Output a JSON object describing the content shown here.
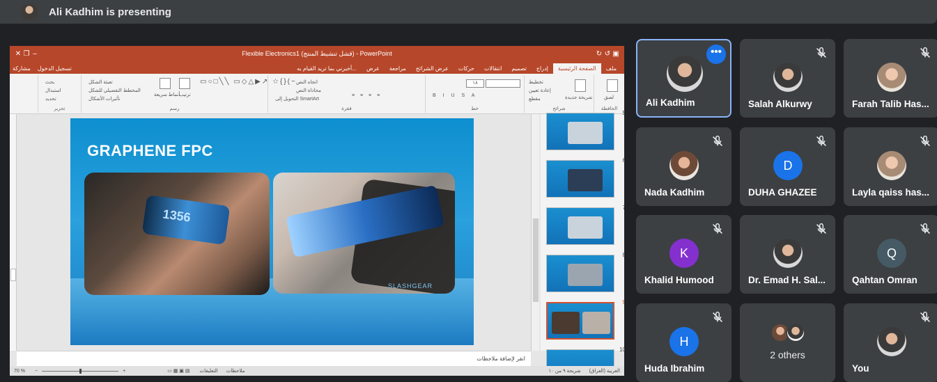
{
  "presenting_banner": "Ali Kadhim is presenting",
  "ppt": {
    "window_title": "Flexible Electronics1 (قشل تنشيط المنتج) - PowerPoint",
    "tabs": [
      "ملف",
      "الصفحة الرئيسية",
      "إدراج",
      "تصميم",
      "انتقالات",
      "حركات",
      "عرض الشرائح",
      "مراجعة",
      "عرض"
    ],
    "tell_me": "أخبرني بما تريد القيام به...",
    "sign_in": "تسجيل الدخول",
    "share": "مشاركة",
    "ribbon": {
      "clipboard": "الحافظة",
      "paste": "لصق",
      "slides": "شرائح",
      "new_slide": "شريحة جديدة",
      "layout": "تخطيط",
      "reset": "إعادة تعيين",
      "section": "مقطع",
      "font": "خط",
      "font_size": "١٨",
      "paragraph": "فقرة",
      "text_direction": "اتجاه النص",
      "align_text": "محاذاة النص",
      "smartart": "التحويل إلى SmartArt",
      "drawing": "رسم",
      "arrange": "ترتيب",
      "quick_styles": "أنماط سريعة",
      "shape_fill": "تعبئة الشكل",
      "shape_outline": "المخطط التفصيلي للشكل",
      "shape_effects": "تأثيرات الأشكال",
      "editing": "تحرير",
      "find": "بحث",
      "replace": "استبدال",
      "select": "تحديد"
    },
    "slide": {
      "title": "GRAPHENE FPC",
      "watermark": "SLASHGEAR",
      "band_text": "1356"
    },
    "thumbnails": [
      "5",
      "6",
      "7",
      "8",
      "9",
      "10"
    ],
    "selected_thumbnail": "9",
    "notes_placeholder": "انقر لإضافة ملاحظات",
    "status": {
      "slide_info": "شريحة ٩ من ١٠",
      "language": "العربية (العراق)",
      "notes": "ملاحظات",
      "comments": "التعليقات",
      "zoom": "70 %"
    }
  },
  "participants": [
    {
      "name": "Ali Kadhim",
      "avatar": "photo",
      "active": true,
      "muted": false
    },
    {
      "name": "Salah Alkurwy",
      "avatar": "photo",
      "muted": true
    },
    {
      "name": "Farah Talib Has...",
      "avatar": "photo",
      "muted": true
    },
    {
      "name": "Nada Kadhim",
      "avatar": "photo",
      "muted": true
    },
    {
      "name": "DUHA GHAZEE",
      "avatar": "D",
      "avatar_color": "#1a73e8",
      "muted": true
    },
    {
      "name": "Layla qaiss has...",
      "avatar": "photo",
      "muted": true
    },
    {
      "name": "Khalid Humood",
      "avatar": "K",
      "avatar_color": "#8430ce",
      "muted": true
    },
    {
      "name": "Dr. Emad H. Sal...",
      "avatar": "photo",
      "muted": true
    },
    {
      "name": "Qahtan Omran",
      "avatar": "Q",
      "avatar_color": "#455a64",
      "muted": true
    },
    {
      "name": "Huda Ibrahim",
      "avatar": "H",
      "avatar_color": "#1a73e8",
      "muted": true
    },
    {
      "name": "2 others",
      "avatar": "group",
      "muted": false
    },
    {
      "name": "You",
      "avatar": "photo",
      "muted": true
    }
  ],
  "more_options_glyph": "•••"
}
